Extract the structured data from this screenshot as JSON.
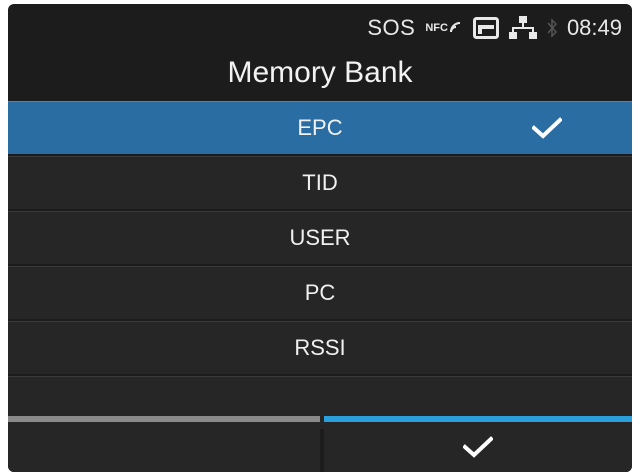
{
  "status_bar": {
    "sos_label": "SOS",
    "nfc_label": "NFC",
    "time": "08:49",
    "icons": [
      "nfc-icon",
      "card-icon",
      "network-icon",
      "bluetooth-icon"
    ]
  },
  "title": "Memory Bank",
  "menu": {
    "items": [
      {
        "label": "EPC",
        "selected": true
      },
      {
        "label": "TID",
        "selected": false
      },
      {
        "label": "USER",
        "selected": false
      },
      {
        "label": "PC",
        "selected": false
      },
      {
        "label": "RSSI",
        "selected": false
      }
    ]
  },
  "bottom_bar": {
    "right_icon": "check-icon"
  },
  "colors": {
    "background": "#1c1c1c",
    "selected_row": "#2a6da3",
    "accent_bar": "#2a9fdc",
    "inactive_bar": "#8a8a8a"
  }
}
